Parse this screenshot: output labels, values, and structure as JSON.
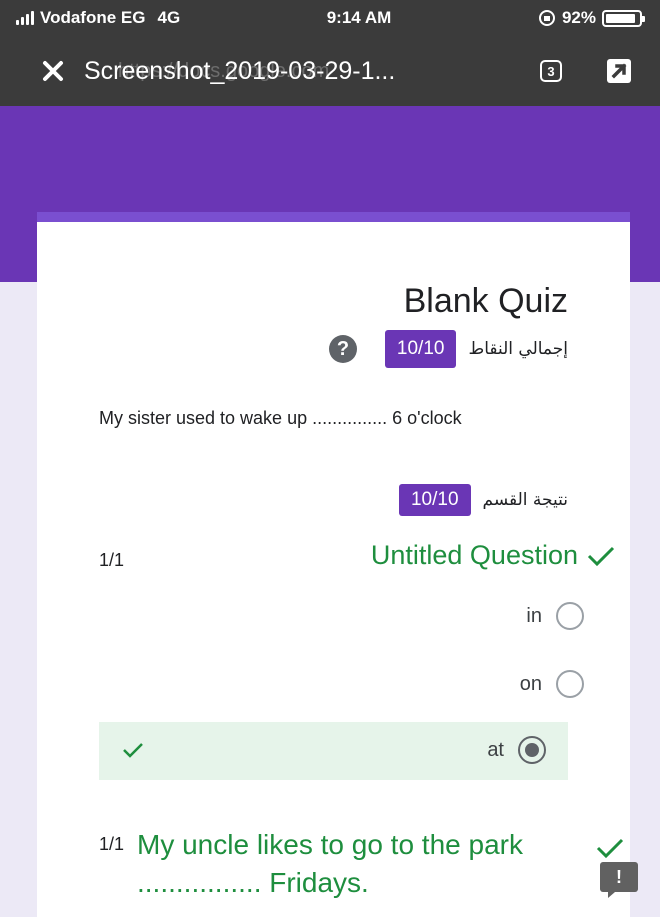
{
  "status_bar": {
    "carrier": "Vodafone EG",
    "network": "4G",
    "time": "9:14 AM",
    "battery": "92%",
    "battery_level": 0.92
  },
  "toolbar": {
    "ghost_url": "https://docs.google.com",
    "title": "Screenshot_2019-03-29-1...",
    "page_count": "3"
  },
  "form": {
    "title": "Blank Quiz",
    "total_points_label": "إجمالي النقاط",
    "total_score": "10/10",
    "question_text": "My  sister used to wake up ............... 6 o'clock",
    "section_label": "نتيجة القسم",
    "section_score": "10/10",
    "q1": {
      "points": "1/1",
      "title": "Untitled Question",
      "options": [
        "in",
        "on",
        "at"
      ],
      "selected": "at"
    },
    "q2": {
      "points": "1/1",
      "title": "My uncle likes to go to the park ................ Fridays."
    }
  },
  "colors": {
    "accent": "#6a36b5",
    "correct": "#1e8e3e",
    "toolbar": "#3b3b3b"
  }
}
